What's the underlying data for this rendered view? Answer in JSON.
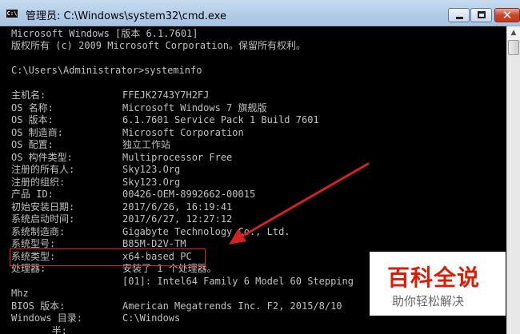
{
  "window": {
    "title": "管理员: C:\\Windows\\system32\\cmd.exe",
    "icon": "cmd-icon",
    "close_symbol": "✕"
  },
  "console": {
    "header1": "Microsoft Windows [版本 6.1.7601]",
    "header2": "版权所有 (c) 2009 Microsoft Corporation。保留所有权利。",
    "prompt": "C:\\Users\\Administrator>systeminfo",
    "rows": [
      {
        "label": "主机名:",
        "value": "FFEJK2743Y7H2FJ"
      },
      {
        "label": "OS 名称:",
        "value": "Microsoft Windows 7 旗舰版"
      },
      {
        "label": "OS 版本:",
        "value": "6.1.7601 Service Pack 1 Build 7601"
      },
      {
        "label": "OS 制造商:",
        "value": "Microsoft Corporation"
      },
      {
        "label": "OS 配置:",
        "value": "独立工作站"
      },
      {
        "label": "OS 构件类型:",
        "value": "Multiprocessor Free"
      },
      {
        "label": "注册的所有人:",
        "value": "Sky123.Org"
      },
      {
        "label": "注册的组织:",
        "value": "Sky123.Org"
      },
      {
        "label": "产品 ID:",
        "value": "00426-OEM-8992662-00015"
      },
      {
        "label": "初始安装日期:",
        "value": "2017/6/26, 16:19:41"
      },
      {
        "label": "系统启动时间:",
        "value": "2017/6/27, 12:27:12"
      },
      {
        "label": "系统制造商:",
        "value": "Gigabyte Technology Co., Ltd."
      },
      {
        "label": "系统型号:",
        "value": "B85M-D2V-TM"
      },
      {
        "label": "系统类型:",
        "value": "x64-based PC"
      },
      {
        "label": "处理器:",
        "value": "安装了 1 个处理器。"
      },
      {
        "label": "",
        "value": "[01]: Intel64 Family 6 Model 60 Stepping"
      },
      {
        "label": "Mhz",
        "value": ""
      },
      {
        "label": "BIOS 版本:",
        "value": "American Megatrends Inc. F2, 2015/8/10"
      },
      {
        "label": "Windows 目录:",
        "value": "C:\\Windows"
      },
      {
        "label": "       半:",
        "value": ""
      }
    ]
  },
  "watermark": {
    "title": "百科全说",
    "subtitle": "助你轻松解决"
  },
  "colors": {
    "annotation": "#d22222",
    "console_text": "#c0c0c0",
    "console_bg": "#000000"
  }
}
